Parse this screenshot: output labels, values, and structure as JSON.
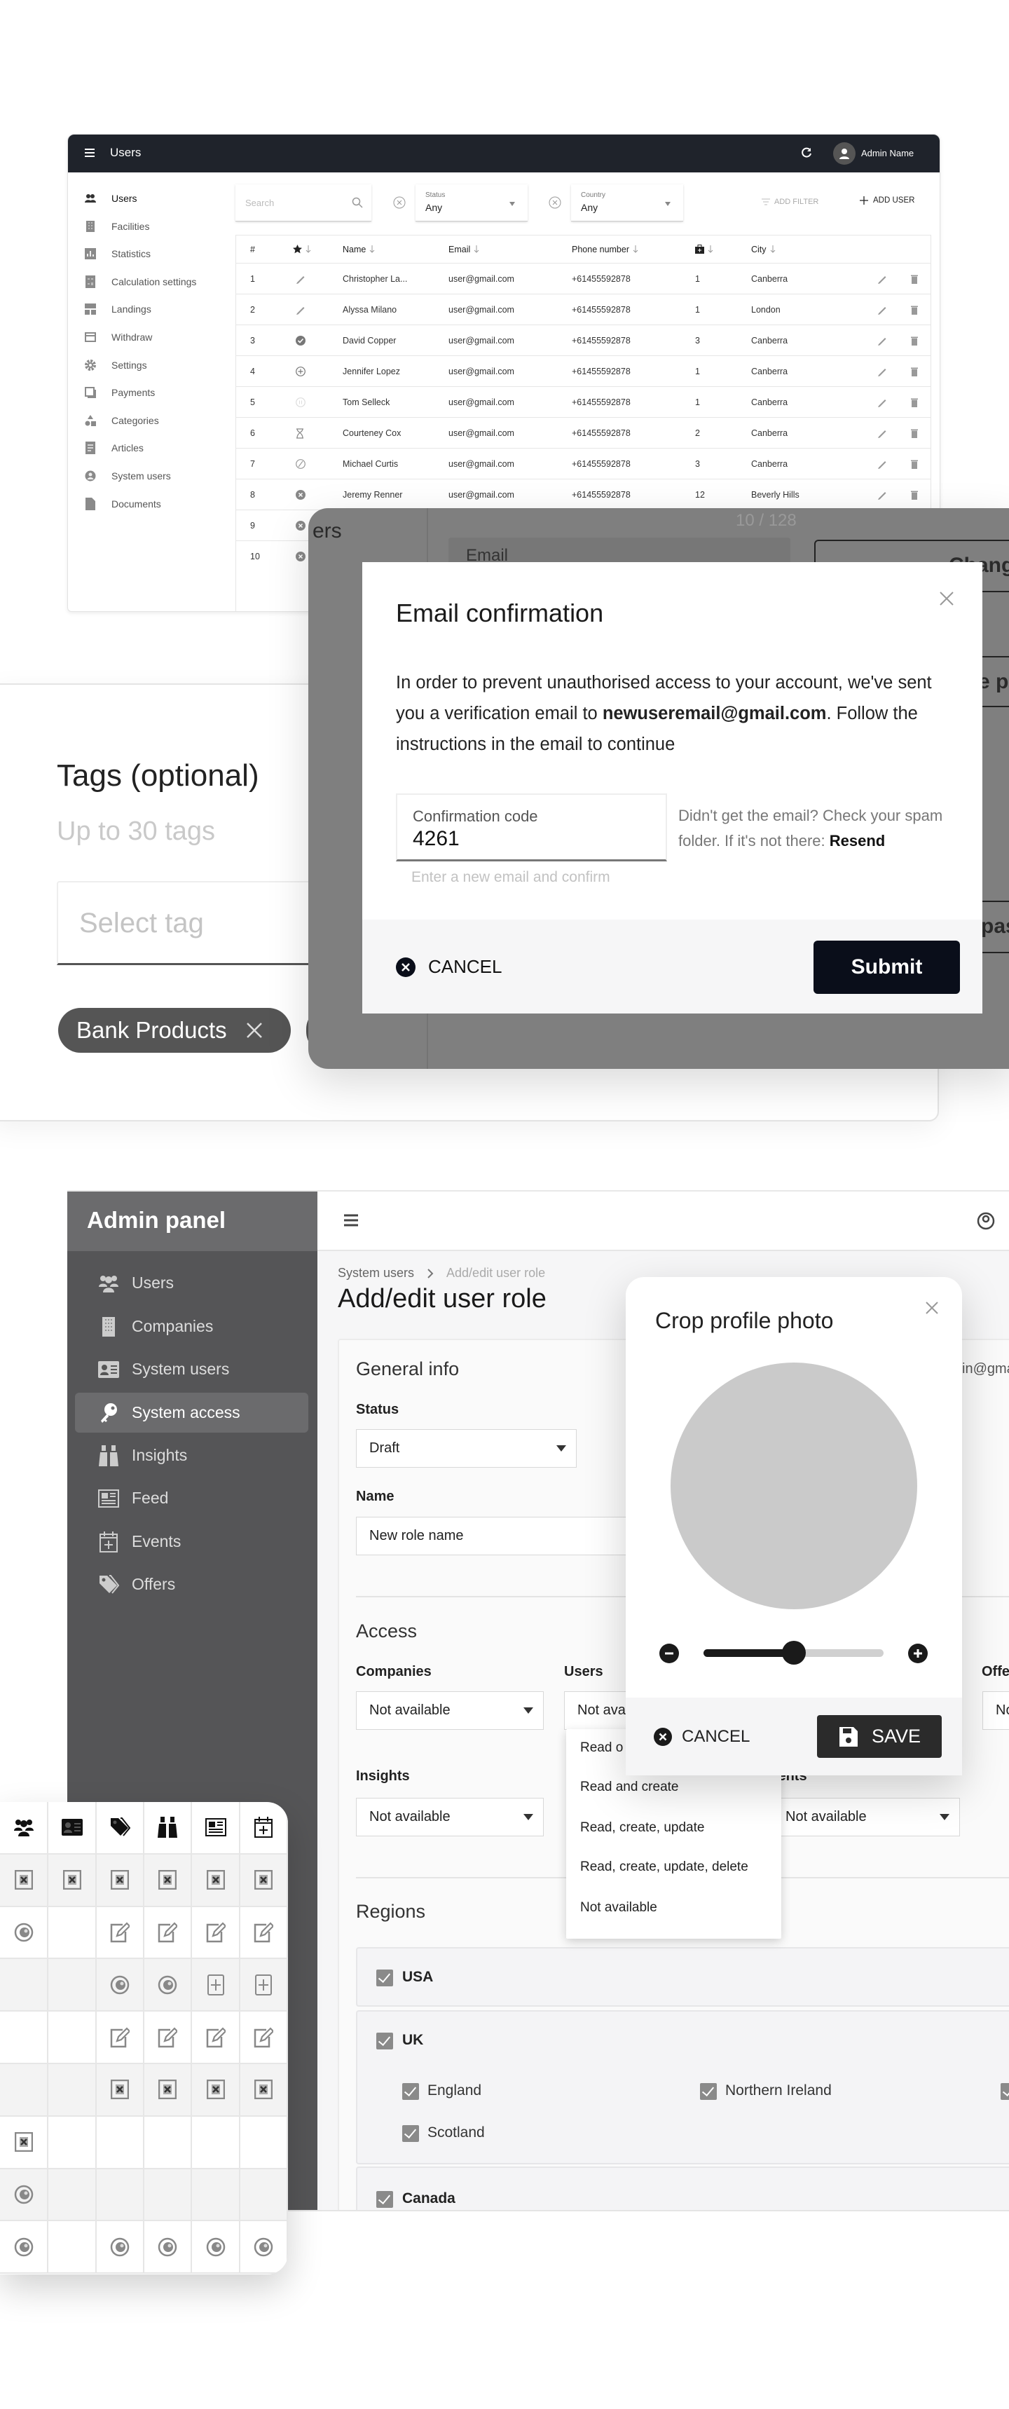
{
  "users_app": {
    "title": "Users",
    "admin_name": "Admin Name",
    "sidebar": [
      {
        "label": "Users",
        "icon": "users-icon",
        "active": true
      },
      {
        "label": "Facilities",
        "icon": "building-icon"
      },
      {
        "label": "Statistics",
        "icon": "chart-icon"
      },
      {
        "label": "Calculation settings",
        "icon": "calculator-icon"
      },
      {
        "label": "Landings",
        "icon": "layout-icon"
      },
      {
        "label": "Withdraw",
        "icon": "card-icon"
      },
      {
        "label": "Settings",
        "icon": "gear-icon"
      },
      {
        "label": "Payments",
        "icon": "payments-icon"
      },
      {
        "label": "Categories",
        "icon": "categories-icon"
      },
      {
        "label": "Articles",
        "icon": "article-icon"
      },
      {
        "label": "System users",
        "icon": "person-icon"
      },
      {
        "label": "Documents",
        "icon": "document-icon"
      }
    ],
    "search_placeholder": "Search",
    "status_filter": {
      "label": "Status",
      "value": "Any"
    },
    "country_filter": {
      "label": "Country",
      "value": "Any"
    },
    "add_filter": "ADD FILTER",
    "add_user": "ADD USER",
    "columns": [
      "#",
      "",
      "Name",
      "Email",
      "Phone number",
      "",
      "City"
    ],
    "rows": [
      {
        "n": "1",
        "status": "pen",
        "name": "Christopher La...",
        "email": "user@gmail.com",
        "phone": "+61455592878",
        "count": "1",
        "city": "Canberra"
      },
      {
        "n": "2",
        "status": "pen",
        "name": "Alyssa Milano",
        "email": "user@gmail.com",
        "phone": "+61455592878",
        "count": "1",
        "city": "London"
      },
      {
        "n": "3",
        "status": "check-circle",
        "name": "David Copper",
        "email": "user@gmail.com",
        "phone": "+61455592878",
        "count": "3",
        "city": "Canberra"
      },
      {
        "n": "4",
        "status": "plus-circle",
        "name": "Jennifer Lopez",
        "email": "user@gmail.com",
        "phone": "+61455592878",
        "count": "1",
        "city": "Canberra"
      },
      {
        "n": "5",
        "status": "pause-circle",
        "name": "Tom Selleck",
        "email": "user@gmail.com",
        "phone": "+61455592878",
        "count": "1",
        "city": "Canberra"
      },
      {
        "n": "6",
        "status": "hourglass",
        "name": "Courteney Cox",
        "email": "user@gmail.com",
        "phone": "+61455592878",
        "count": "2",
        "city": "Canberra"
      },
      {
        "n": "7",
        "status": "ban",
        "name": "Michael Curtis",
        "email": "user@gmail.com",
        "phone": "+61455592878",
        "count": "3",
        "city": "Canberra"
      },
      {
        "n": "8",
        "status": "x-circle",
        "name": "Jeremy Renner",
        "email": "user@gmail.com",
        "phone": "+61455592878",
        "count": "12",
        "city": "Beverly Hills"
      },
      {
        "n": "9",
        "status": "x-circle"
      },
      {
        "n": "10",
        "status": "x-circle"
      }
    ]
  },
  "backdrop": {
    "heading_fragment": "ers",
    "counter": "10 / 128",
    "email_label": "Email",
    "button_1_fragment": "Change e",
    "button_2_fragment": "e pl",
    "button_3_fragment": "pas"
  },
  "tags": {
    "title": "Tags (optional)",
    "subtitle": "Up to 30 tags",
    "placeholder": "Select tag",
    "chip": "Bank Products"
  },
  "email_modal": {
    "title": "Email confirmation",
    "body_before": "In order to prevent unauthorised access to your account, we've sent you a verification email to ",
    "email": "newuseremail@gmail.com",
    "body_after": ". Follow the instructions in the email to continue",
    "code_label": "Confirmation code",
    "code_value": "4261",
    "helper": "Enter a new email and confirm",
    "side_text": "Didn't get the email? Check your spam folder. If it's not there: ",
    "resend": "Resend",
    "cancel": "CANCEL",
    "submit": "Submit"
  },
  "admin": {
    "brand": "Admin panel",
    "sidebar": [
      {
        "label": "Users",
        "icon": "users-group-icon"
      },
      {
        "label": "Companies",
        "icon": "building-icon"
      },
      {
        "label": "System users",
        "icon": "id-card-icon"
      },
      {
        "label": "System access",
        "icon": "key-icon",
        "active": true
      },
      {
        "label": "Insights",
        "icon": "binoculars-icon"
      },
      {
        "label": "Feed",
        "icon": "newspaper-icon"
      },
      {
        "label": "Events",
        "icon": "calendar-plus-icon"
      },
      {
        "label": "Offers",
        "icon": "tags-icon"
      }
    ],
    "breadcrumb": [
      "System users",
      "Add/edit user role"
    ],
    "title": "Add/edit user role",
    "general_info": "General info",
    "status_label": "Status",
    "status_value": "Draft",
    "name_label": "Name",
    "name_value": "New role name",
    "email_fragment": "in@gma",
    "access_title": "Access",
    "access": {
      "companies": {
        "label": "Companies",
        "value": "Not available"
      },
      "users": {
        "label": "Users",
        "value": "Not ava"
      },
      "offers": {
        "label": "Offe",
        "value": "No"
      },
      "insights": {
        "label": "Insights",
        "value": "Not available"
      },
      "events": {
        "label": "Events",
        "value": "Not available"
      }
    },
    "dropdown_options": [
      "Read o",
      "Read and create",
      "Read, create, update",
      "Read, create, update, delete",
      "Not available"
    ],
    "regions_title": "Regions",
    "regions": {
      "usa": {
        "label": "USA",
        "checked": true
      },
      "uk": {
        "label": "UK",
        "checked": true,
        "children": [
          {
            "label": "England",
            "checked": true
          },
          {
            "label": "Northern Ireland",
            "checked": true
          },
          {
            "label": "Scotland",
            "checked": true
          }
        ]
      },
      "canada": {
        "label": "Canada",
        "checked": true
      }
    }
  },
  "crop_modal": {
    "title": "Crop profile photo",
    "zoom_level": 0.5,
    "cancel": "CANCEL",
    "save": "SAVE"
  },
  "permissions": {
    "columns": [
      "users-group-icon",
      "id-card-icon",
      "tags-icon",
      "binoculars-icon",
      "newspaper-icon",
      "calendar-plus-icon"
    ],
    "rows": [
      [
        "x-square",
        "x-square",
        "x-square",
        "x-square",
        "x-square",
        "x-square"
      ],
      [
        "eye",
        "",
        "edit-square",
        "edit-square",
        "edit-square",
        "edit-square"
      ],
      [
        "",
        "",
        "eye",
        "eye",
        "plus-square",
        "plus-square"
      ],
      [
        "",
        "",
        "edit-square",
        "edit-square",
        "edit-square",
        "edit-square"
      ],
      [
        "",
        "",
        "x-square",
        "x-square",
        "x-square",
        "x-square"
      ],
      [
        "x-square",
        "",
        "",
        "",
        "",
        ""
      ],
      [
        "eye",
        "",
        "",
        "",
        "",
        ""
      ],
      [
        "eye",
        "",
        "eye",
        "eye",
        "eye",
        "eye"
      ]
    ]
  },
  "colors": {
    "dark_header": "#1f232b",
    "submit": "#0a0e1a",
    "admin_sidebar": "#555557",
    "chip": "#555555"
  }
}
